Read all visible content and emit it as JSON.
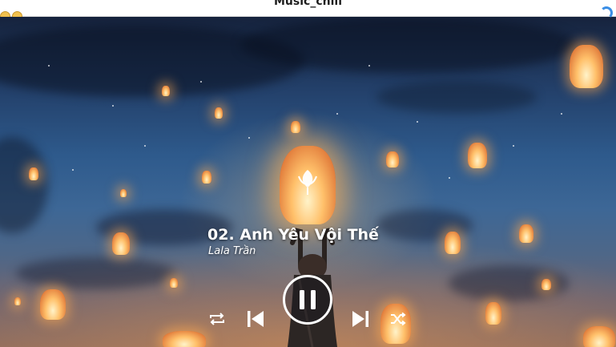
{
  "window": {
    "title": "Music_chill"
  },
  "player": {
    "track_title": "02. Anh Yêu Vội Thế",
    "artist": "Lala Trần",
    "state": "playing"
  },
  "controls": {
    "repeat_icon": "repeat-icon",
    "previous_icon": "skip-previous-icon",
    "pause_icon": "pause-icon",
    "next_icon": "skip-next-icon",
    "shuffle_icon": "shuffle-icon"
  },
  "colors": {
    "control": "#ffffff",
    "titlebar": "#ffffff"
  }
}
